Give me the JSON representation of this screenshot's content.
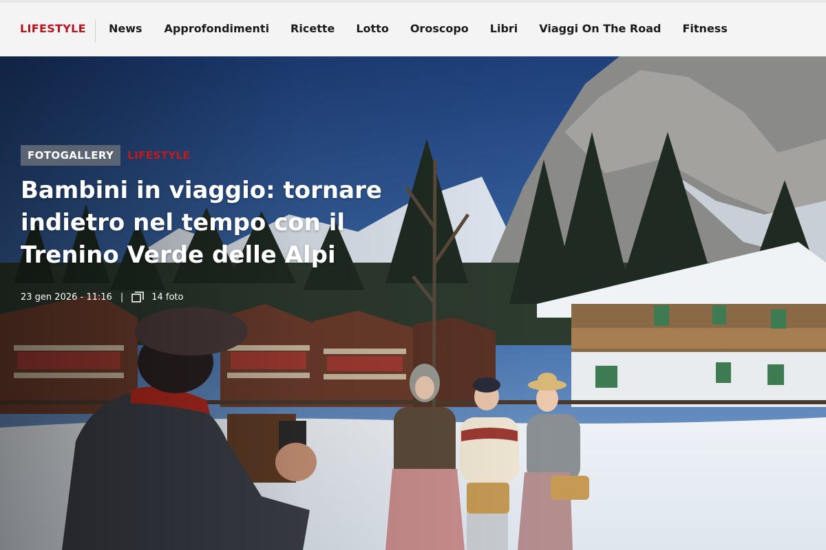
{
  "nav": {
    "brand": "LIFESTYLE",
    "items": [
      {
        "label": "News"
      },
      {
        "label": "Approfondimenti"
      },
      {
        "label": "Ricette"
      },
      {
        "label": "Lotto"
      },
      {
        "label": "Oroscopo"
      },
      {
        "label": "Libri"
      },
      {
        "label": "Viaggi On The Road"
      },
      {
        "label": "Fitness"
      }
    ]
  },
  "article": {
    "tag_gallery": "FOTOGALLERY",
    "tag_section": "LIFESTYLE",
    "title": "Bambini in viaggio: tornare indietro nel tempo con il Trenino Verde delle Alpi",
    "datetime": "23 gen 2026 - 11:16",
    "separator": "|",
    "photo_count": "14 foto",
    "photo_icon": "gallery-icon"
  },
  "colors": {
    "brand_red": "#b5121b",
    "tag_gray": "#5a6472"
  }
}
